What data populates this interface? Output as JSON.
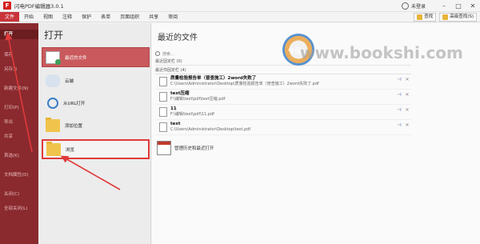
{
  "app": {
    "title": "闪电PDF编辑器3.0.1",
    "user_label": "未登录",
    "icon_glyph": "F",
    "controls": {
      "minimize": "–",
      "restore": "□",
      "close": "✕"
    }
  },
  "menubar": {
    "items": [
      "文件",
      "开始",
      "视图",
      "注释",
      "保护",
      "表单",
      "页面组织",
      "共享",
      "审阅"
    ],
    "right_chips": [
      "查找",
      "高级查找(S)"
    ]
  },
  "sidebar": {
    "items": [
      {
        "label": "打开",
        "active": true
      },
      {
        "label": "保存",
        "active": false
      },
      {
        "label": "另存为",
        "active": false
      },
      {
        "label": "新建文件(N)",
        "active": false
      },
      {
        "label": "打印(P)",
        "active": false
      },
      {
        "label": "导出",
        "active": false
      },
      {
        "label": "共享",
        "active": false
      },
      {
        "label": "首选(K)",
        "active": false
      },
      {
        "label": "文档属性(D)",
        "active": false
      },
      {
        "label": "关闭(C)",
        "active": false
      },
      {
        "label": "全部关闭(L)",
        "active": false
      }
    ]
  },
  "open_panel": {
    "title": "打开",
    "items": [
      {
        "label": "最近的文件",
        "icon": "recent-files-icon",
        "state": "selected"
      },
      {
        "label": "云端",
        "icon": "cloud-icon",
        "state": "normal"
      },
      {
        "label": "从URL打开",
        "icon": "globe-icon",
        "state": "normal"
      },
      {
        "label": "添加位置",
        "icon": "add-folder-icon",
        "state": "normal"
      },
      {
        "label": "浏览",
        "icon": "folder-icon",
        "state": "highlight"
      }
    ]
  },
  "recent": {
    "title": "最近的文件",
    "search_placeholder": "搜索...",
    "pinned_header": "最近固定栏 (0)",
    "recent_header": "最近你固定栏 (4)",
    "files": [
      {
        "name": "质量检验报告单（普查施工）2word失败了",
        "path": "C:\\Users\\Administrator\\Desktop\\质量检验报告单（普查施工）2word失败了.pdf"
      },
      {
        "name": "text压缩",
        "path": "F:\\编辑\\text\\pdf\\text压缩.pdf"
      },
      {
        "name": "11",
        "path": "F:\\编辑\\text\\pdf\\11.pdf"
      },
      {
        "name": "text",
        "path": "C:\\Users\\Administrator\\Desktop\\text.pdf"
      }
    ],
    "pin_glyph": "⊣",
    "remove_glyph": "✕",
    "history_label": "管理历史和最近打开"
  },
  "watermark": {
    "logo_text": "今日",
    "text": "www.bookshi.com"
  },
  "colors": {
    "accent_red": "#c8343a",
    "sidebar": "#8a2a2e",
    "selected": "#c9595c",
    "annotation": "#e03a3a"
  }
}
